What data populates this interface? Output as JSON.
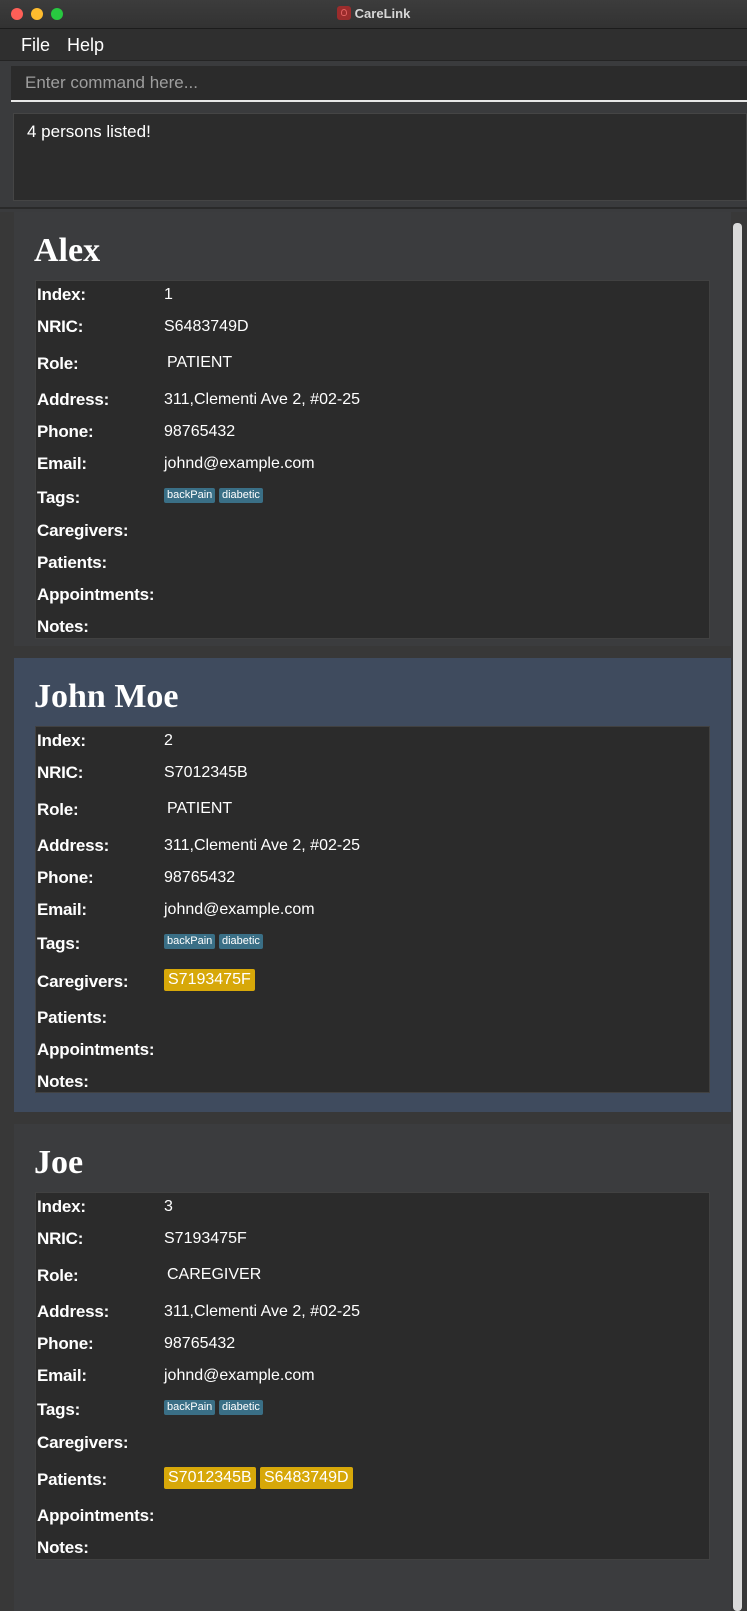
{
  "window": {
    "title": "CareLink"
  },
  "menu": {
    "items": [
      "File",
      "Help"
    ]
  },
  "command": {
    "placeholder": "Enter command here...",
    "value": ""
  },
  "result": {
    "text": "4 persons listed!"
  },
  "labels": {
    "index": "Index:",
    "nric": "NRIC:",
    "role": "Role:",
    "address": "Address:",
    "phone": "Phone:",
    "email": "Email:",
    "tags": "Tags:",
    "caregivers": "Caregivers:",
    "patients": "Patients:",
    "appointments": "Appointments:",
    "notes": "Notes:"
  },
  "persons": [
    {
      "name": "Alex",
      "index": "1",
      "nric": "S6483749D",
      "role": "PATIENT",
      "address": "311,Clementi Ave 2, #02-25",
      "phone": "98765432",
      "email": "johnd@example.com",
      "tags": [
        "backPain",
        "diabetic"
      ],
      "caregivers": [],
      "patients": [],
      "selected": false
    },
    {
      "name": "John Moe",
      "index": "2",
      "nric": "S7012345B",
      "role": "PATIENT",
      "address": "311,Clementi Ave 2, #02-25",
      "phone": "98765432",
      "email": "johnd@example.com",
      "tags": [
        "backPain",
        "diabetic"
      ],
      "caregivers": [
        "S7193475F"
      ],
      "patients": [],
      "selected": true
    },
    {
      "name": "Joe",
      "index": "3",
      "nric": "S7193475F",
      "role": "CAREGIVER",
      "address": "311,Clementi Ave 2, #02-25",
      "phone": "98765432",
      "email": "johnd@example.com",
      "tags": [
        "backPain",
        "diabetic"
      ],
      "caregivers": [],
      "patients": [
        "S7012345B",
        "S6483749D"
      ],
      "selected": false
    }
  ],
  "colors": {
    "tag": "#3a6f86",
    "reference": "#d7a809",
    "selected_card": "#3f4b5e"
  }
}
